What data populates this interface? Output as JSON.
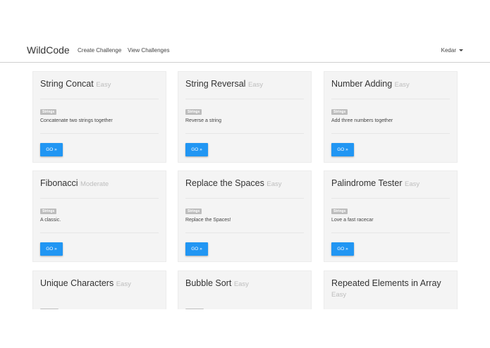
{
  "navbar": {
    "brand": "WildCode",
    "links": [
      "Create Challenge",
      "View Challenges"
    ],
    "user": "Kedar"
  },
  "challenges": [
    {
      "title": "String Concat",
      "difficulty": "Easy",
      "tag": "Strings",
      "description": "Concatenate two strings together",
      "button": "GO »"
    },
    {
      "title": "String Reversal",
      "difficulty": "Easy",
      "tag": "Strings",
      "description": "Reverse a string",
      "button": "GO »"
    },
    {
      "title": "Number Adding",
      "difficulty": "Easy",
      "tag": "Strings",
      "description": "Add three numbers together",
      "button": "GO »"
    },
    {
      "title": "Fibonacci",
      "difficulty": "Moderate",
      "tag": "Strings",
      "description": "A classic.",
      "button": "GO »"
    },
    {
      "title": "Replace the Spaces",
      "difficulty": "Easy",
      "tag": "Strings",
      "description": "Replace the Spaces!",
      "button": "GO »"
    },
    {
      "title": "Palindrome Tester",
      "difficulty": "Easy",
      "tag": "Strings",
      "description": "Love a fast racecar",
      "button": "GO »"
    },
    {
      "title": "Unique Characters",
      "difficulty": "Easy"
    },
    {
      "title": "Bubble Sort",
      "difficulty": "Easy"
    },
    {
      "title": "Repeated Elements in Array",
      "difficulty": "Easy"
    }
  ],
  "colors": {
    "accent": "#2196f3",
    "card": "#f4f4f4",
    "tag": "#bdbdbd"
  }
}
